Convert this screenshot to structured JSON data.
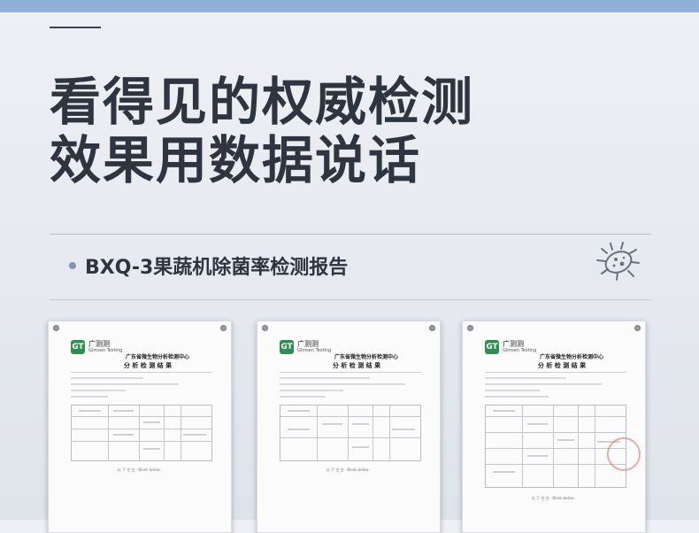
{
  "headline": {
    "line1": "看得见的权威检测",
    "line2": "效果用数据说话"
  },
  "subtitle": "BXQ-3果蔬机除菌率检测报告",
  "bug_icon": "bacteria-icon",
  "colors": {
    "top_bar": "#8eb0d9",
    "accent_dot": "#7f95b8",
    "text": "#2e3440",
    "logo": "#2f8f4e"
  },
  "documents": [
    {
      "logo_text": "GT",
      "lab_name": "广测测",
      "lab_en": "Gimsen Testing",
      "center_name": "广东省微生物分析检测中心",
      "title": "分 析 检 测 结 果",
      "footer": "以 下 空 白 · Blank below ·"
    },
    {
      "logo_text": "GT",
      "lab_name": "广测测",
      "lab_en": "Gimsen Testing",
      "center_name": "广东省微生物分析检测中心",
      "title": "分 析 检 测 结 果",
      "footer": "以 下 空 白 · Blank below ·"
    },
    {
      "logo_text": "GT",
      "lab_name": "广测测",
      "lab_en": "Gimsen Testing",
      "center_name": "广东省微生物分析检测中心",
      "title": "分 析 检 测 结 果",
      "footer": "以 下 空 白 · Blank below ·"
    }
  ]
}
